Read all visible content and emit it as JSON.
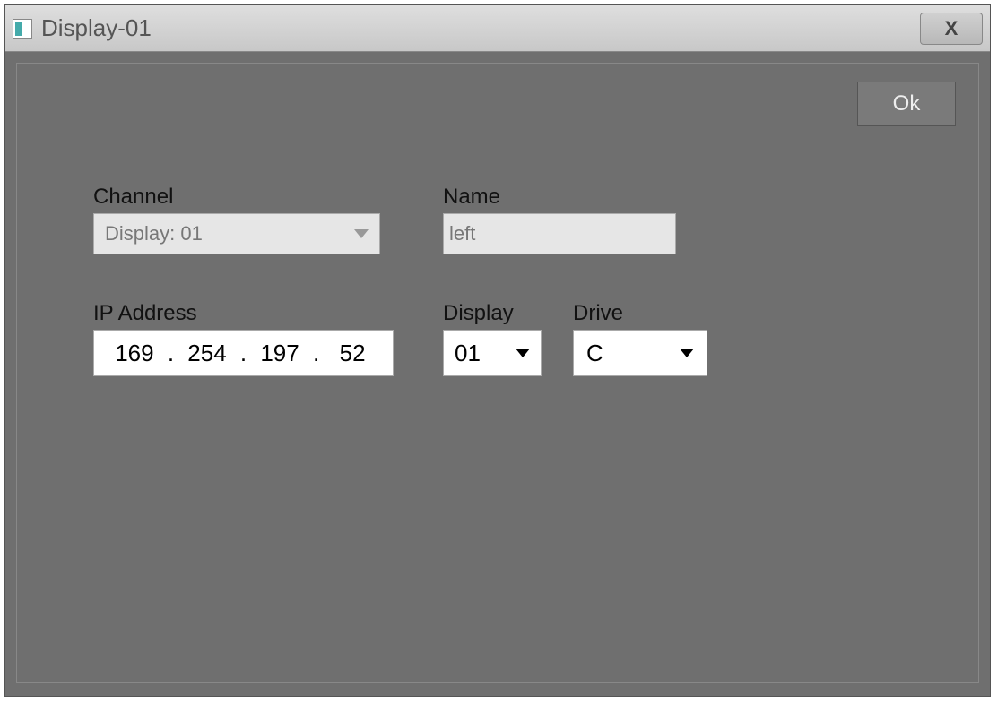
{
  "window": {
    "title": "Display-01"
  },
  "buttons": {
    "ok": "Ok",
    "close": "X"
  },
  "fields": {
    "channel": {
      "label": "Channel",
      "value": "Display: 01"
    },
    "name": {
      "label": "Name",
      "value": "left"
    },
    "ip": {
      "label": "IP Address",
      "seg1": "169",
      "seg2": "254",
      "seg3": "197",
      "seg4": "52"
    },
    "display": {
      "label": "Display",
      "value": "01"
    },
    "drive": {
      "label": "Drive",
      "value": "C"
    }
  }
}
